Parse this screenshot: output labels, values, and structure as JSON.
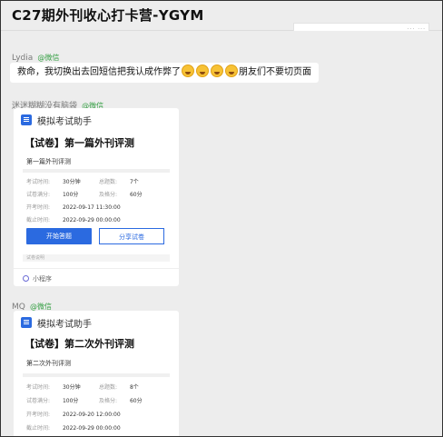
{
  "window": {
    "title": "C27期外刊收心打卡营-YGYM",
    "menu_dots": "··· ···"
  },
  "messages": [
    {
      "sender": "Lydia",
      "source": "@微信",
      "text_before": "救命，我切换出去回短信把我认成作弊了",
      "emoji_count": 4,
      "emoji_name": "grinning-sweat-face",
      "text_after": "朋友们不要切页面"
    },
    {
      "sender": "迷迷糊糊没有脑袋",
      "source": "@微信",
      "card": {
        "app": "模拟考试助手",
        "title": "【试卷】第一篇外刊评测",
        "subtitle": "第一篇外刊评测",
        "fields": {
          "duration_label": "考试时间:",
          "duration": "30分钟",
          "questions_label": "总题数:",
          "questions": "7个",
          "fullscore_label": "试卷满分:",
          "fullscore": "100分",
          "pass_label": "及格分:",
          "pass": "60分",
          "start_label": "开考时间:",
          "start": "2022-09-17 11:30:00",
          "end_label": "截止时间:",
          "end": "2022-09-29 00:00:00"
        },
        "start_button": "开始答题",
        "share_button": "分享试卷",
        "footer_note": "试卷说明",
        "mini_program": "小程序"
      }
    },
    {
      "sender": "MQ",
      "source": "@微信",
      "card": {
        "app": "模拟考试助手",
        "title": "【试卷】第二次外刊评测",
        "subtitle": "第二次外刊评测",
        "fields": {
          "duration_label": "考试时间:",
          "duration": "30分钟",
          "questions_label": "总题数:",
          "questions": "8个",
          "fullscore_label": "试卷满分:",
          "fullscore": "100分",
          "pass_label": "及格分:",
          "pass": "60分",
          "start_label": "开考时间:",
          "start": "2022-09-20 12:00:00",
          "end_label": "截止时间:",
          "end": "2022-09-29 00:00:00"
        }
      }
    }
  ],
  "colors": {
    "accent": "#2b6ae0",
    "wechat_green": "#36a045",
    "background": "#ededed"
  }
}
